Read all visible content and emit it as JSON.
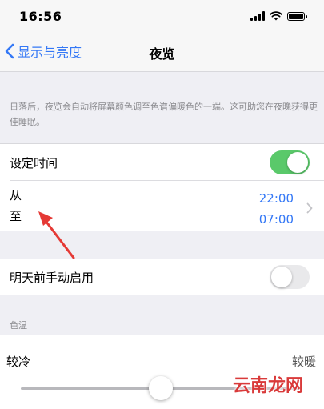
{
  "status_bar": {
    "time": "16:56"
  },
  "nav": {
    "back_label": "显示与亮度",
    "title": "夜览"
  },
  "description": "日落后，夜览会自动将屏幕颜色调至色谱偏暖色的一端。这可助您在夜晚获得更佳睡眠。",
  "scheduled": {
    "label": "设定时间",
    "enabled": true
  },
  "schedule": {
    "from_label": "从",
    "to_label": "至",
    "from_time": "22:00",
    "to_time": "07:00"
  },
  "manual": {
    "label": "明天前手动启用",
    "enabled": false
  },
  "color_temp": {
    "section_label": "色温",
    "cooler_label": "较冷",
    "warmer_label": "较暖",
    "value": 0.5
  },
  "watermark": "云南龙网",
  "colors": {
    "accent": "#3478f6",
    "toggle_on": "#5ac96a",
    "arrow": "#e53935"
  }
}
